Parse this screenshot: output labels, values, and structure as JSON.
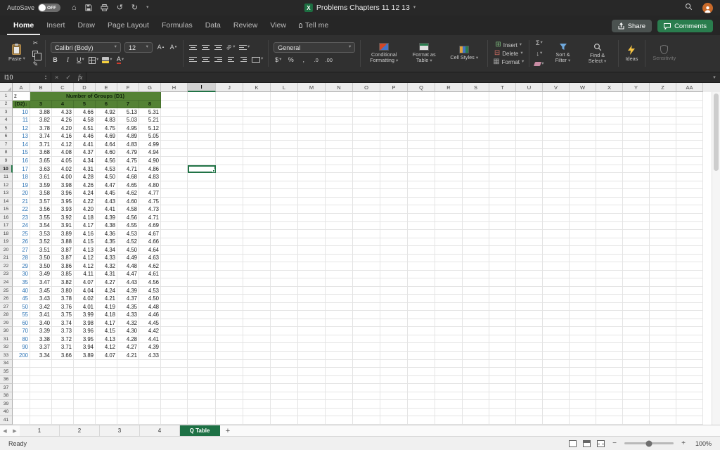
{
  "colors": {
    "selection": "#217346",
    "header_green": "#548235",
    "tab_green": "#1e7145",
    "df_blue": "#2e74b5"
  },
  "titlebar": {
    "autosave_label": "AutoSave",
    "autosave_state": "OFF",
    "document_title": "Problems Chapters 11 12 13"
  },
  "ribbon": {
    "tabs": [
      {
        "label": "Home",
        "active": true
      },
      {
        "label": "Insert"
      },
      {
        "label": "Draw"
      },
      {
        "label": "Page Layout"
      },
      {
        "label": "Formulas"
      },
      {
        "label": "Data"
      },
      {
        "label": "Review"
      },
      {
        "label": "View"
      },
      {
        "label": "Tell me",
        "icon": "bulb"
      }
    ],
    "share_label": "Share",
    "comments_label": "Comments",
    "clipboard": {
      "paste_label": "Paste"
    },
    "font": {
      "name": "Calibri (Body)",
      "size": "12",
      "bold": "B",
      "italic": "I",
      "underline": "U"
    },
    "number": {
      "format": "General",
      "currency": "$",
      "percent": "%",
      "comma": ",",
      "increase_decimal": ".0",
      "decrease_decimal": ".00"
    },
    "styles": {
      "conditional": "Conditional Formatting",
      "table": "Format as Table",
      "cell": "Cell Styles"
    },
    "cells": {
      "insert": "Insert",
      "delete": "Delete",
      "format": "Format"
    },
    "editing": {
      "autosum": "Σ",
      "sort_filter": "Sort & Filter",
      "find_select": "Find & Select"
    },
    "ideas_label": "Ideas",
    "sensitivity_label": "Sensitivity"
  },
  "formula_bar": {
    "name_box": "I10",
    "fx_label": "fx"
  },
  "sheet": {
    "columns": [
      "A",
      "B",
      "C",
      "D",
      "E",
      "F",
      "G",
      "H",
      "I",
      "J",
      "K",
      "L",
      "M",
      "N",
      "O",
      "P",
      "Q",
      "R",
      "S",
      "T",
      "U",
      "V",
      "W",
      "X",
      "Y",
      "Z",
      "AA"
    ],
    "row_numbers": [
      1,
      2,
      3,
      4,
      5,
      6,
      7,
      8,
      9,
      10,
      11,
      12,
      13,
      14,
      15,
      16,
      17,
      18,
      19,
      20,
      21,
      22,
      23,
      24,
      25,
      26,
      27,
      28,
      29,
      30,
      31,
      32,
      33,
      34,
      35,
      36,
      37,
      38,
      39,
      40,
      41
    ],
    "selected_cell": {
      "col": "I",
      "row": 10
    },
    "cells": {
      "a1": "z",
      "d2_label": "(D2)↓",
      "groups_title": "Number of Groups (D1)",
      "group_numbers": [
        "3",
        "4",
        "5",
        "6",
        "7",
        "8"
      ]
    },
    "table": {
      "df": [
        "10",
        "11",
        "12",
        "13",
        "14",
        "15",
        "16",
        "17",
        "18",
        "19",
        "20",
        "21",
        "22",
        "23",
        "24",
        "25",
        "26",
        "27",
        "28",
        "29",
        "30",
        "35",
        "40",
        "45",
        "50",
        "55",
        "60",
        "70",
        "80",
        "90",
        "200"
      ],
      "q_values": [
        [
          "3.88",
          "4.33",
          "4.66",
          "4.92",
          "5.13",
          "5.31"
        ],
        [
          "3.82",
          "4.26",
          "4.58",
          "4.83",
          "5.03",
          "5.21"
        ],
        [
          "3.78",
          "4.20",
          "4.51",
          "4.75",
          "4.95",
          "5.12"
        ],
        [
          "3.74",
          "4.16",
          "4.46",
          "4.69",
          "4.89",
          "5.05"
        ],
        [
          "3.71",
          "4.12",
          "4.41",
          "4.64",
          "4.83",
          "4.99"
        ],
        [
          "3.68",
          "4.08",
          "4.37",
          "4.60",
          "4.79",
          "4.94"
        ],
        [
          "3.65",
          "4.05",
          "4.34",
          "4.56",
          "4.75",
          "4.90"
        ],
        [
          "3.63",
          "4.02",
          "4.31",
          "4.53",
          "4.71",
          "4.86"
        ],
        [
          "3.61",
          "4.00",
          "4.28",
          "4.50",
          "4.68",
          "4.83"
        ],
        [
          "3.59",
          "3.98",
          "4.26",
          "4.47",
          "4.65",
          "4.80"
        ],
        [
          "3.58",
          "3.96",
          "4.24",
          "4.45",
          "4.62",
          "4.77"
        ],
        [
          "3.57",
          "3.95",
          "4.22",
          "4.43",
          "4.60",
          "4.75"
        ],
        [
          "3.56",
          "3.93",
          "4.20",
          "4.41",
          "4.58",
          "4.73"
        ],
        [
          "3.55",
          "3.92",
          "4.18",
          "4.39",
          "4.56",
          "4.71"
        ],
        [
          "3.54",
          "3.91",
          "4.17",
          "4.38",
          "4.55",
          "4.69"
        ],
        [
          "3.53",
          "3.89",
          "4.16",
          "4.36",
          "4.53",
          "4.67"
        ],
        [
          "3.52",
          "3.88",
          "4.15",
          "4.35",
          "4.52",
          "4.66"
        ],
        [
          "3.51",
          "3.87",
          "4.13",
          "4.34",
          "4.50",
          "4.64"
        ],
        [
          "3.50",
          "3.87",
          "4.12",
          "4.33",
          "4.49",
          "4.63"
        ],
        [
          "3.50",
          "3.86",
          "4.12",
          "4.32",
          "4.48",
          "4.62"
        ],
        [
          "3.49",
          "3.85",
          "4.11",
          "4.31",
          "4.47",
          "4.61"
        ],
        [
          "3.47",
          "3.82",
          "4.07",
          "4.27",
          "4.43",
          "4.56"
        ],
        [
          "3.45",
          "3.80",
          "4.04",
          "4.24",
          "4.39",
          "4.53"
        ],
        [
          "3.43",
          "3.78",
          "4.02",
          "4.21",
          "4.37",
          "4.50"
        ],
        [
          "3.42",
          "3.76",
          "4.01",
          "4.19",
          "4.35",
          "4.48"
        ],
        [
          "3.41",
          "3.75",
          "3.99",
          "4.18",
          "4.33",
          "4.46"
        ],
        [
          "3.40",
          "3.74",
          "3.98",
          "4.17",
          "4.32",
          "4.45"
        ],
        [
          "3.39",
          "3.73",
          "3.96",
          "4.15",
          "4.30",
          "4.42"
        ],
        [
          "3.38",
          "3.72",
          "3.95",
          "4.13",
          "4.28",
          "4.41"
        ],
        [
          "3.37",
          "3.71",
          "3.94",
          "4.12",
          "4.27",
          "4.39"
        ],
        [
          "3.34",
          "3.66",
          "3.89",
          "4.07",
          "4.21",
          "4.33"
        ]
      ]
    }
  },
  "sheet_tabs": {
    "tabs": [
      {
        "label": "1"
      },
      {
        "label": "2"
      },
      {
        "label": "3"
      },
      {
        "label": "4"
      },
      {
        "label": "Q Table",
        "active": true
      }
    ],
    "add_label": "+"
  },
  "status_bar": {
    "mode": "Ready",
    "zoom": "100%",
    "zoom_out": "−",
    "zoom_in": "+"
  }
}
